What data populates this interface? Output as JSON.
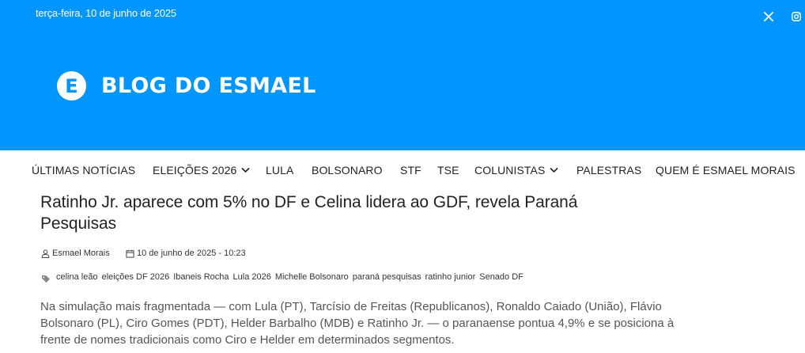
{
  "header": {
    "date": "terça-feira, 10 de junho de 2025",
    "logo_letter": "E",
    "logo_text": "BLOG DO ESMAEL",
    "social": [
      "x-icon",
      "instagram-icon"
    ],
    "colors": {
      "brand": "#0095ff",
      "text": "#222222"
    }
  },
  "nav": {
    "items": [
      {
        "label": "ÚLTIMAS NOTÍCIAS",
        "dropdown": false
      },
      {
        "label": "ELEIÇÕES 2026",
        "dropdown": true
      },
      {
        "label": "LULA",
        "dropdown": false
      },
      {
        "label": "BOLSONARO",
        "dropdown": false
      },
      {
        "label": "STF",
        "dropdown": false
      },
      {
        "label": "TSE",
        "dropdown": false
      },
      {
        "label": "COLUNISTAS",
        "dropdown": true
      },
      {
        "label": "PALESTRAS",
        "dropdown": false
      },
      {
        "label": "QUEM É ESMAEL MORAIS",
        "dropdown": false
      }
    ]
  },
  "article": {
    "title": "Ratinho Jr. aparece com 5% no DF e Celina lidera ao GDF, revela Paraná Pesquisas",
    "author": "Esmael Morais",
    "datetime": "10 de junho de 2025 - 10:23",
    "tags": [
      "celina leão",
      "eleições DF 2026",
      "Ibaneis Rocha",
      "Lula 2026",
      "Michelle Bolsonaro",
      "paraná pesquisas",
      "ratinho junior",
      "Senado DF"
    ],
    "excerpt": "Na simulação mais fragmentada — com Lula (PT), Tarcísio de Freitas (Republicanos), Ronaldo Caiado (União), Flávio Bolsonaro (PL), Ciro Gomes (PDT), Helder Barbalho (MDB) e Ratinho Jr. — o paranaense pontua 4,9% e se posiciona à frente de nomes tradicionais como Ciro e Helder em determinados segmentos."
  }
}
